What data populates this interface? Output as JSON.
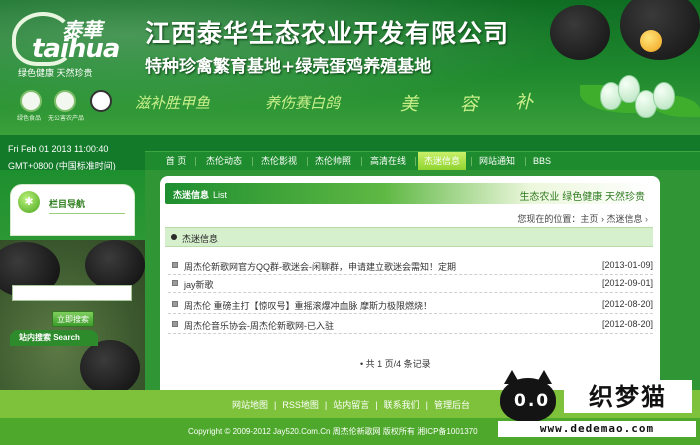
{
  "header": {
    "logo_cn": "泰華",
    "logo_en": "taihua",
    "logo_slogan": "绿色健康 天然珍贵",
    "company_name": "江西泰华生态农业开发有限公司",
    "company_sub": "特种珍禽繁育基地+绿壳蛋鸡养殖基地",
    "cert_1_label": "绿色食品",
    "cert_2_label": "无公害农产品",
    "calligraphy_1": "滋补胜甲鱼",
    "calligraphy_2": "养伤赛白鸽",
    "calligraphy_3": "美",
    "calligraphy_4": "容",
    "calligraphy_5": "补"
  },
  "sidebar": {
    "date": "Fri Feb 01 2013 11:00:40",
    "timezone": "GMT+0800 (中国标准时间)",
    "nav_title": "栏目导航",
    "search_title": "站内搜索 Search",
    "search_placeholder": "",
    "search_button": "立即搜索"
  },
  "nav": {
    "items": [
      {
        "label": "首 页"
      },
      {
        "label": "杰伦动态"
      },
      {
        "label": "杰伦影视"
      },
      {
        "label": "杰伦帅照"
      },
      {
        "label": "高清在线"
      },
      {
        "label": "杰迷信息"
      },
      {
        "label": "网站通知"
      },
      {
        "label": "BBS"
      }
    ],
    "active_index": 5
  },
  "content": {
    "header_title": "杰迷信息",
    "header_title_en": "List",
    "header_slogan": "生态农业 绿色健康 天然珍贵",
    "breadcrumb_prefix": "您现在的位置：",
    "breadcrumb_home": "主页",
    "breadcrumb_sep": "›",
    "breadcrumb_current": "杰迷信息",
    "breadcrumb_arrow": "›",
    "section_title": "杰迷信息",
    "news": [
      {
        "title": "周杰伦新歌网官方QQ群-歌迷会-闲聊群，申请建立歌迷会需知！定期",
        "date": "[2013-01-09]"
      },
      {
        "title": "jay新歌",
        "date": "[2012-09-01]"
      },
      {
        "title": "周杰伦 重磅主打【惊叹号】重摇滚爆冲血脉 摩斯力极限燃烧！",
        "date": "[2012-08-20]"
      },
      {
        "title": "周杰伦音乐协会-周杰伦新歌网-已入驻",
        "date": "[2012-08-20]"
      }
    ],
    "pager": "• 共 1 页/4 条记录"
  },
  "footer": {
    "links": [
      "网站地图",
      "RSS地图",
      "站内留言",
      "联系我们",
      "管理后台"
    ],
    "link_sep": "|",
    "copyright": "Copyright © 2009-2012 Jay520.Com.Cn 周杰伦新歌网 版权所有 湘ICP备1001370"
  },
  "watermark": {
    "eyes": "0.0",
    "brand": "织梦猫",
    "url": "www.dedemao.com"
  },
  "colors": {
    "header_green": "#1f8a2e",
    "nav_green": "#137a2a",
    "nav_active": "#8cd22c",
    "footer_light": "#7dc23a",
    "footer_dark": "#4ea82b",
    "section_bg": "#d6efcd"
  }
}
